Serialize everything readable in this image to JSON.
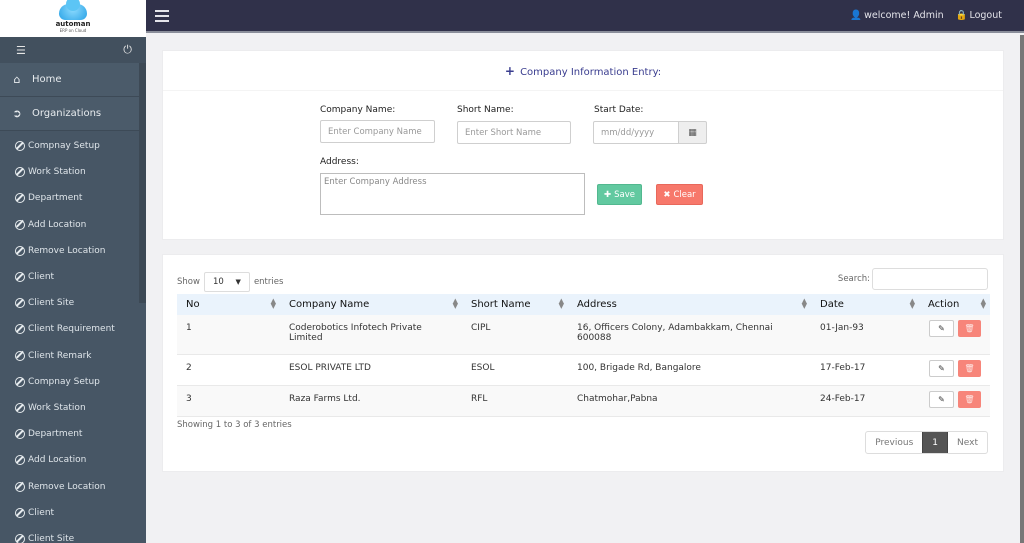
{
  "brand": {
    "name": "automan",
    "tagline": "ERP on Cloud"
  },
  "sidebar": {
    "main_items": [
      {
        "label": "Home",
        "icon": "home-icon"
      },
      {
        "label": "Organizations",
        "icon": "circle-arrow-right-icon"
      }
    ],
    "items": [
      {
        "label": "Compnay Setup"
      },
      {
        "label": "Work Station"
      },
      {
        "label": "Department"
      },
      {
        "label": "Add Location"
      },
      {
        "label": "Remove Location"
      },
      {
        "label": "Client"
      },
      {
        "label": "Client Site"
      },
      {
        "label": "Client Requirement"
      },
      {
        "label": "Client Remark"
      },
      {
        "label": "Compnay Setup"
      },
      {
        "label": "Work Station"
      },
      {
        "label": "Department"
      },
      {
        "label": "Add Location"
      },
      {
        "label": "Remove Location"
      },
      {
        "label": "Client"
      },
      {
        "label": "Client Site"
      }
    ]
  },
  "topbar": {
    "welcome": "welcome! Admin",
    "logout": "Logout"
  },
  "form": {
    "title": "Company Information Entry:",
    "company_name_label": "Company Name:",
    "company_name_placeholder": "Enter Company Name",
    "short_name_label": "Short Name:",
    "short_name_placeholder": "Enter Short Name",
    "start_date_label": "Start Date:",
    "start_date_placeholder": "mm/dd/yyyy",
    "address_label": "Address:",
    "address_placeholder": "Enter Company Address",
    "save_label": "Save",
    "clear_label": "Clear"
  },
  "table": {
    "show_label": "Show",
    "page_size": "10",
    "entries_label": "entries",
    "search_label": "Search:",
    "columns": [
      "No",
      "Company Name",
      "Short Name",
      "Address",
      "Date",
      "Action"
    ],
    "rows": [
      {
        "no": "1",
        "company": "Coderobotics Infotech Private Limited",
        "short": "CIPL",
        "address": "16, Officers Colony, Adambakkam, Chennai 600088",
        "date": "01-Jan-93"
      },
      {
        "no": "2",
        "company": "ESOL PRIVATE LTD",
        "short": "ESOL",
        "address": "100, Brigade Rd, Bangalore",
        "date": "17-Feb-17"
      },
      {
        "no": "3",
        "company": "Raza Farms Ltd.",
        "short": "RFL",
        "address": "Chatmohar,Pabna",
        "date": "24-Feb-17"
      }
    ],
    "info": "Showing 1 to 3 of 3 entries",
    "pagination": {
      "previous": "Previous",
      "current": "1",
      "next": "Next"
    }
  },
  "colors": {
    "topbar": "#30314a",
    "sidebar": "#475665",
    "save": "#62c9a0",
    "clear": "#f7786b",
    "title": "#3a3d8f"
  }
}
